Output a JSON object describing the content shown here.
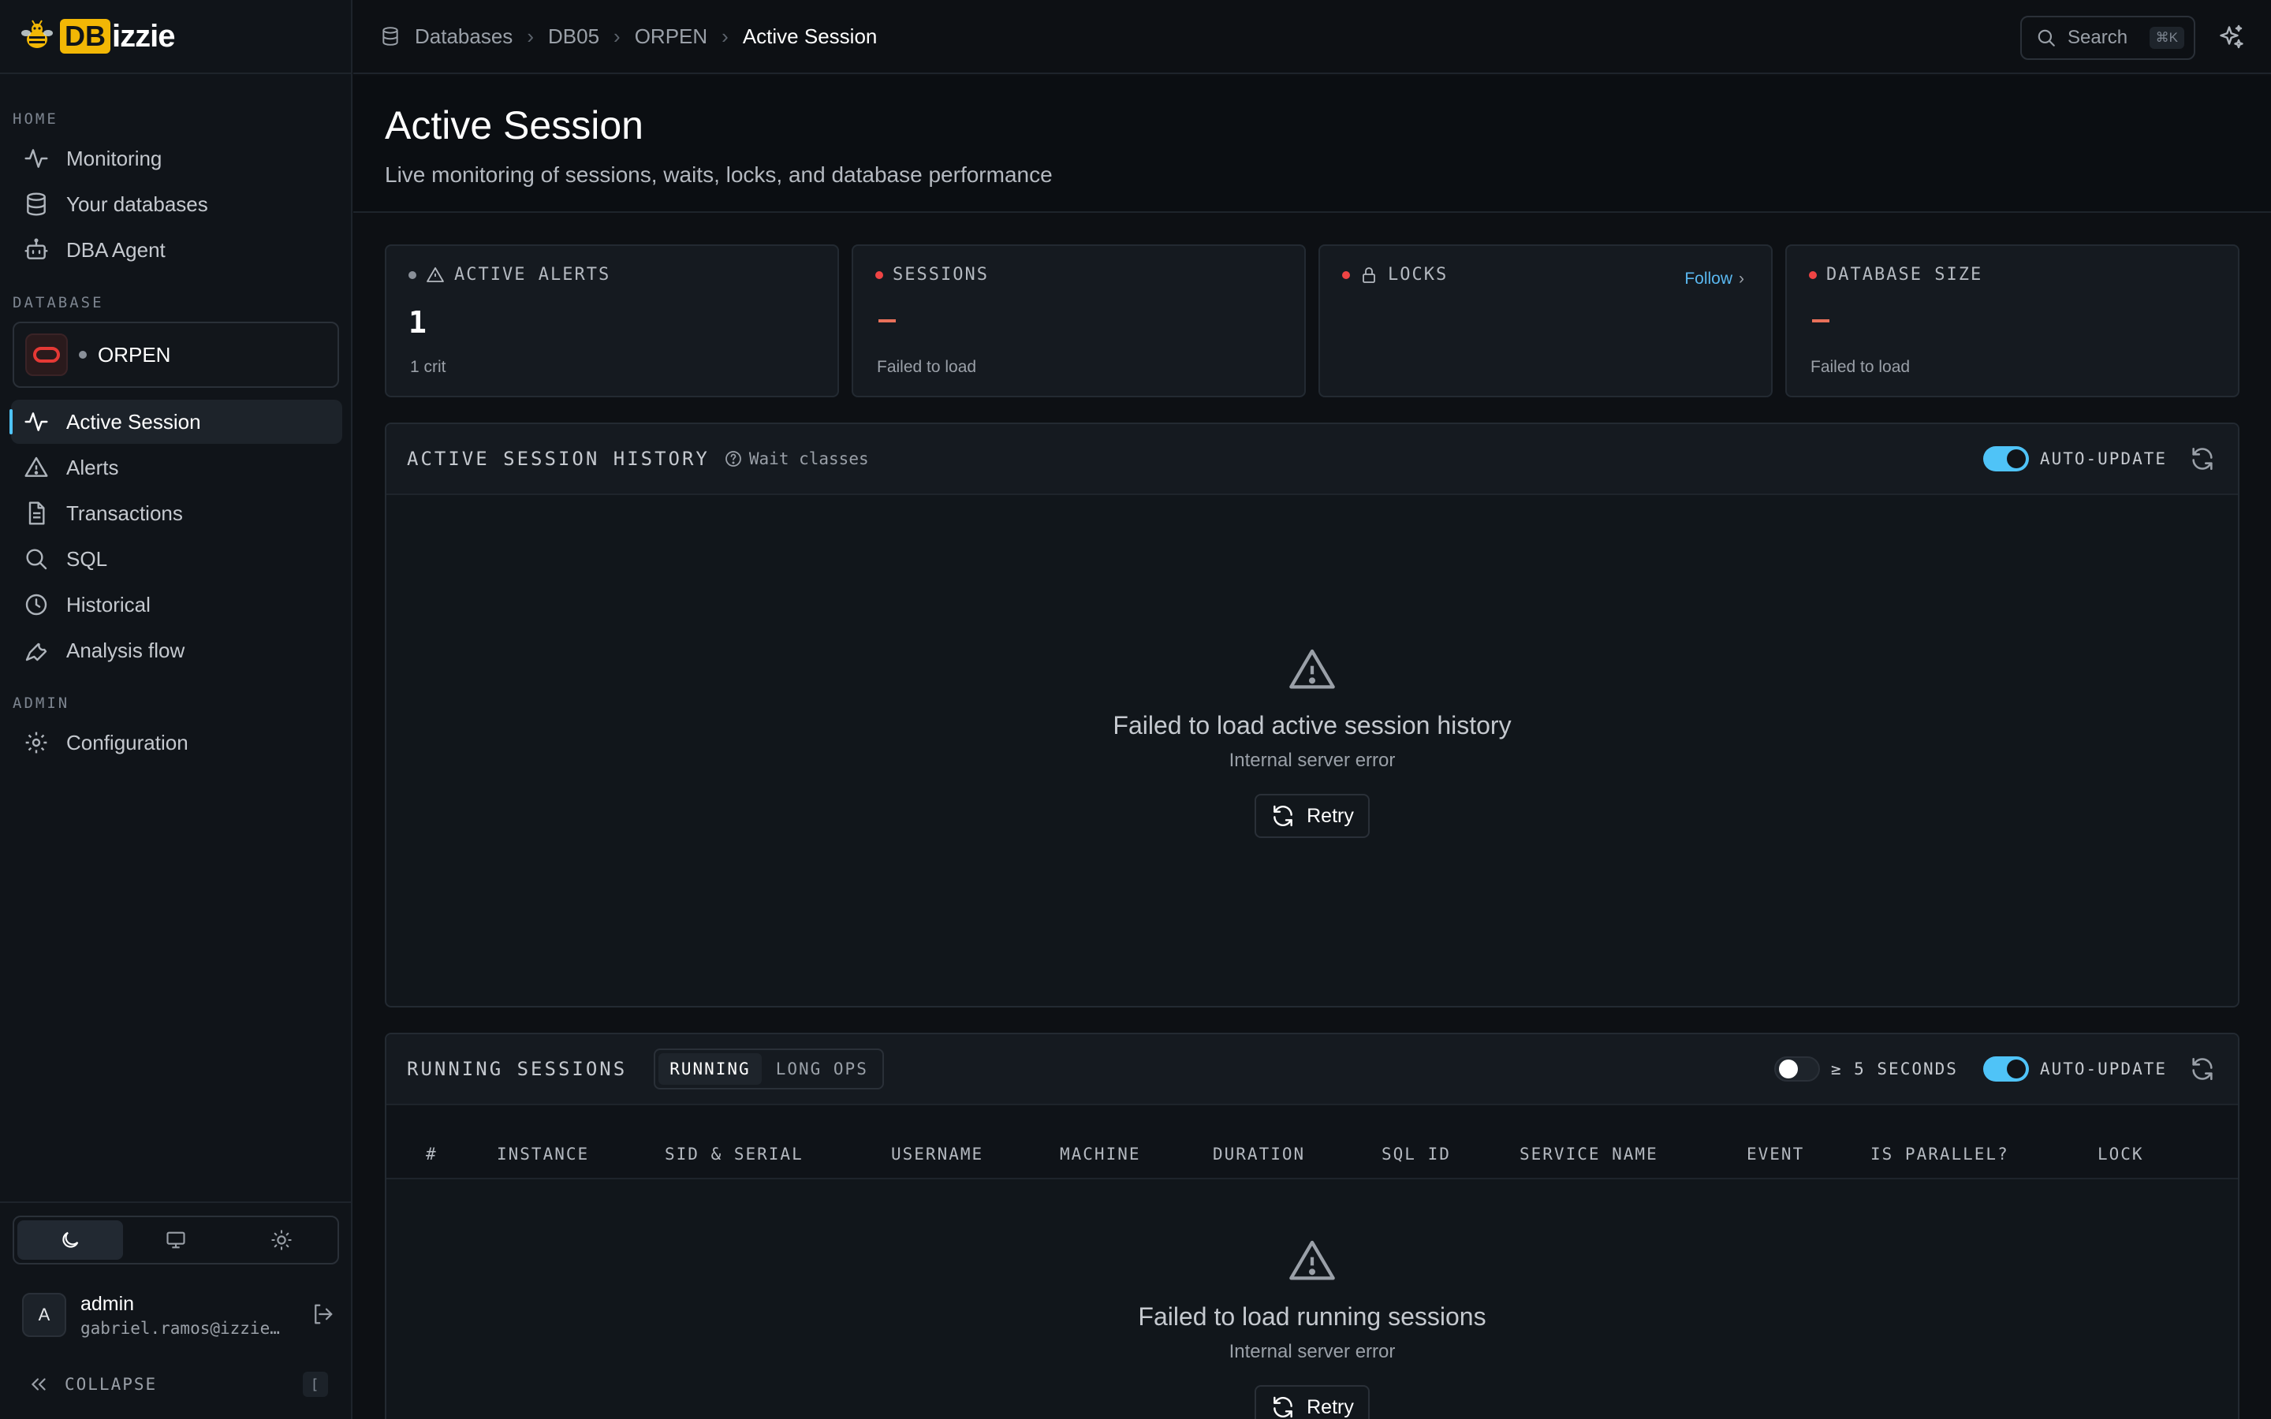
{
  "app": {
    "name_prefix": "DB",
    "name_suffix": "izzie"
  },
  "sidebar": {
    "sections": {
      "home": "HOME",
      "database": "DATABASE",
      "admin": "ADMIN"
    },
    "home_items": [
      {
        "label": "Monitoring",
        "icon": "activity-icon"
      },
      {
        "label": "Your databases",
        "icon": "database-icon"
      },
      {
        "label": "DBA Agent",
        "icon": "robot-icon"
      }
    ],
    "database_selector": {
      "name": "ORPEN",
      "icon": "oracle-icon"
    },
    "database_items": [
      {
        "label": "Active Session",
        "icon": "activity-icon",
        "active": true
      },
      {
        "label": "Alerts",
        "icon": "warning-icon"
      },
      {
        "label": "Transactions",
        "icon": "file-icon"
      },
      {
        "label": "SQL",
        "icon": "search-icon"
      },
      {
        "label": "Historical",
        "icon": "clock-icon"
      },
      {
        "label": "Analysis flow",
        "icon": "wrench-icon"
      }
    ],
    "admin_items": [
      {
        "label": "Configuration",
        "icon": "gear-icon"
      }
    ],
    "theme": {
      "options": [
        "dark",
        "system",
        "light"
      ],
      "selected": "dark"
    },
    "user": {
      "initial": "A",
      "name": "admin",
      "email": "gabriel.ramos@izzie…"
    },
    "collapse": {
      "label": "COLLAPSE",
      "shortcut": "["
    }
  },
  "topbar": {
    "breadcrumbs": [
      "Databases",
      "DB05",
      "ORPEN",
      "Active Session"
    ],
    "search": {
      "label": "Search",
      "shortcut": "⌘K"
    }
  },
  "page": {
    "title": "Active Session",
    "subtitle": "Live monitoring of sessions, waits, locks, and database performance"
  },
  "cards": {
    "alerts": {
      "label": "ACTIVE ALERTS",
      "value": "1",
      "foot": "1 crit"
    },
    "sessions": {
      "label": "SESSIONS",
      "foot": "Failed to load"
    },
    "locks": {
      "label": "LOCKS",
      "link": "Follow"
    },
    "dbsize": {
      "label": "DATABASE SIZE",
      "foot": "Failed to load"
    }
  },
  "ash": {
    "title": "ACTIVE SESSION HISTORY",
    "hint": "Wait classes",
    "auto_update_label": "AUTO-UPDATE",
    "auto_update": true,
    "error_title": "Failed to load active session history",
    "error_sub": "Internal server error",
    "retry": "Retry"
  },
  "running": {
    "title": "RUNNING SESSIONS",
    "tabs": [
      "RUNNING",
      "LONG OPS"
    ],
    "active_tab": "RUNNING",
    "filter_label": "≥ 5 SECONDS",
    "filter_on": false,
    "auto_update_label": "AUTO-UPDATE",
    "auto_update": true,
    "columns": [
      "#",
      "INSTANCE",
      "SID & SERIAL",
      "USERNAME",
      "MACHINE",
      "DURATION",
      "SQL ID",
      "SERVICE NAME",
      "EVENT",
      "IS PARALLEL?",
      "LOCK"
    ],
    "error_title": "Failed to load running sessions",
    "error_sub": "Internal server error",
    "retry": "Retry"
  },
  "colors": {
    "accent": "#4fc3f7",
    "brand": "#f2b705",
    "danger": "#ef4444",
    "link": "#5ab8f0"
  }
}
